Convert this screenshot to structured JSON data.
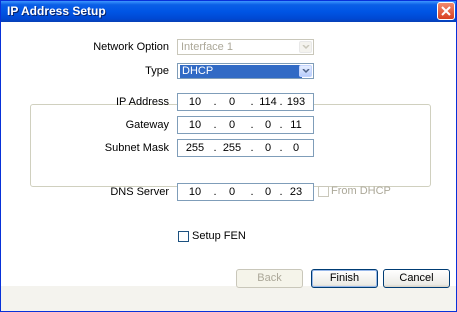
{
  "window": {
    "title": "IP Address Setup"
  },
  "network_option": {
    "label": "Network Option",
    "value": "Interface 1",
    "enabled": false
  },
  "type": {
    "label": "Type",
    "value": "DHCP"
  },
  "ip_address": {
    "label": "IP Address",
    "octets": [
      "10",
      "0",
      "114",
      "193"
    ]
  },
  "gateway": {
    "label": "Gateway",
    "octets": [
      "10",
      "0",
      "0",
      "11"
    ]
  },
  "subnet_mask": {
    "label": "Subnet Mask",
    "octets": [
      "255",
      "255",
      "0",
      "0"
    ]
  },
  "dns_server": {
    "label": "DNS Server",
    "octets": [
      "10",
      "0",
      "0",
      "23"
    ],
    "from_dhcp_label": "From DHCP",
    "from_dhcp_checked": false,
    "from_dhcp_enabled": false
  },
  "setup_fen": {
    "label": "Setup FEN",
    "checked": false
  },
  "buttons": {
    "back": "Back",
    "finish": "Finish",
    "cancel": "Cancel"
  },
  "dot": "."
}
